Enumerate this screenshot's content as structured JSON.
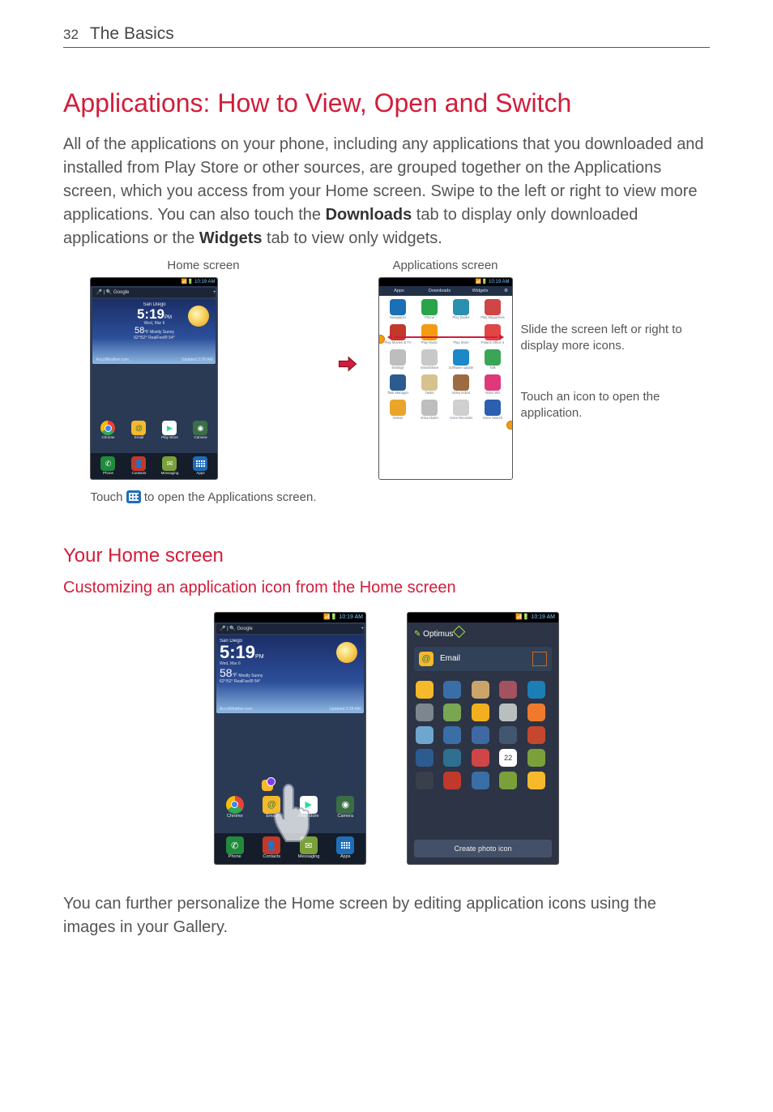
{
  "header": {
    "page_number": "32",
    "section": "The Basics"
  },
  "main_title": "Applications: How to View, Open and Switch",
  "intro_pre": "All of the applications on your phone, including any applications that you downloaded and installed from Play Store or other sources, are grouped together on the Applications screen, which you access from your Home screen. Swipe to the left or right to view more applications. You can also touch the ",
  "intro_bold1": "Downloads",
  "intro_mid": " tab to display only downloaded applications or the ",
  "intro_bold2": "Widgets",
  "intro_post": " tab to view only widgets.",
  "figure1": {
    "home_label": "Home screen",
    "apps_label": "Applications screen",
    "status_time": "10:19 AM",
    "search_placeholder": "Google",
    "weather": {
      "city": "San Diego",
      "time": "5:19",
      "ampm": "PM",
      "date": "Wed, Mar 6",
      "temp": "58",
      "deg": "°F",
      "condition": "Mostly Sunny",
      "hilow": "62°/52°  RealFeel® 54°",
      "provider": "AccuWeather.com",
      "updated": "Updated 3:28 AM"
    },
    "dock": [
      {
        "label": "Chrome"
      },
      {
        "label": "Email"
      },
      {
        "label": "Play Store"
      },
      {
        "label": "Camera"
      }
    ],
    "bottombar": [
      {
        "label": "Phone"
      },
      {
        "label": "Contacts"
      },
      {
        "label": "Messaging"
      },
      {
        "label": "Apps"
      }
    ],
    "caption_pre": "Touch ",
    "caption_post": " to open the Applications screen.",
    "tabs": [
      "Apps",
      "Downloads",
      "Widgets",
      "⚙"
    ],
    "app_grid": [
      {
        "label": "Navigation",
        "color": "#1b6fb5"
      },
      {
        "label": "Phone",
        "color": "#2aa34a"
      },
      {
        "label": "Play Books",
        "color": "#2b8fb0"
      },
      {
        "label": "Play Magazines",
        "color": "#d04545"
      },
      {
        "label": "Play Movies & TV",
        "color": "#c0392b"
      },
      {
        "label": "Play Music",
        "color": "#f39c12"
      },
      {
        "label": "Play Store",
        "color": "#ffffff"
      },
      {
        "label": "Polaris Office 4",
        "color": "#e04646"
      },
      {
        "label": "Settings",
        "color": "#bdbdbd"
      },
      {
        "label": "SmartShare",
        "color": "#c8c8c8"
      },
      {
        "label": "Software update",
        "color": "#1b88c9"
      },
      {
        "label": "Talk",
        "color": "#3aa655"
      },
      {
        "label": "Task Manager",
        "color": "#2c5c8f"
      },
      {
        "label": "Tasks",
        "color": "#d7c28d"
      },
      {
        "label": "Video Editor",
        "color": "#9c6b3f"
      },
      {
        "label": "Video Wiz",
        "color": "#e0397a"
      },
      {
        "label": "Videos",
        "color": "#e9a52a"
      },
      {
        "label": "Voice Dialer",
        "color": "#bdbdbd"
      },
      {
        "label": "Voice Recorder",
        "color": "#cfcfcf"
      },
      {
        "label": "Voice Search",
        "color": "#2b5fb0"
      }
    ],
    "callout1": "Slide the screen left or right to display more icons.",
    "callout2": "Touch an icon to open the application."
  },
  "sub_title": "Your Home screen",
  "sub_sub_title": "Customizing an application icon from the Home screen",
  "figure2": {
    "status_time": "10:19 AM",
    "chooser_title_label": "Optimus",
    "email_label": "Email",
    "create_btn": "Create photo icon",
    "calendar_text": "22",
    "icon_colors": [
      "#f6b92c",
      "#3a6ea6",
      "#caa46a",
      "#a3525f",
      "#1b7fb5",
      "#7d858f",
      "#7aa654",
      "#f2b01e",
      "#b9bfbe",
      "#ef7a2d",
      "#6fa6cf",
      "#3a6ea6",
      "#3f69a3",
      "#42566f",
      "#c5472f",
      "#2c5c8f",
      "#2f6f8f",
      "#d04545",
      "#ffffff",
      "#7aa03a",
      "#3a3f4d",
      "#c0392b",
      "#3a6ea6",
      "#7aa03a",
      "#f6b92c"
    ]
  },
  "closing_text": "You can further personalize the Home screen by editing application icons using the images in your Gallery."
}
